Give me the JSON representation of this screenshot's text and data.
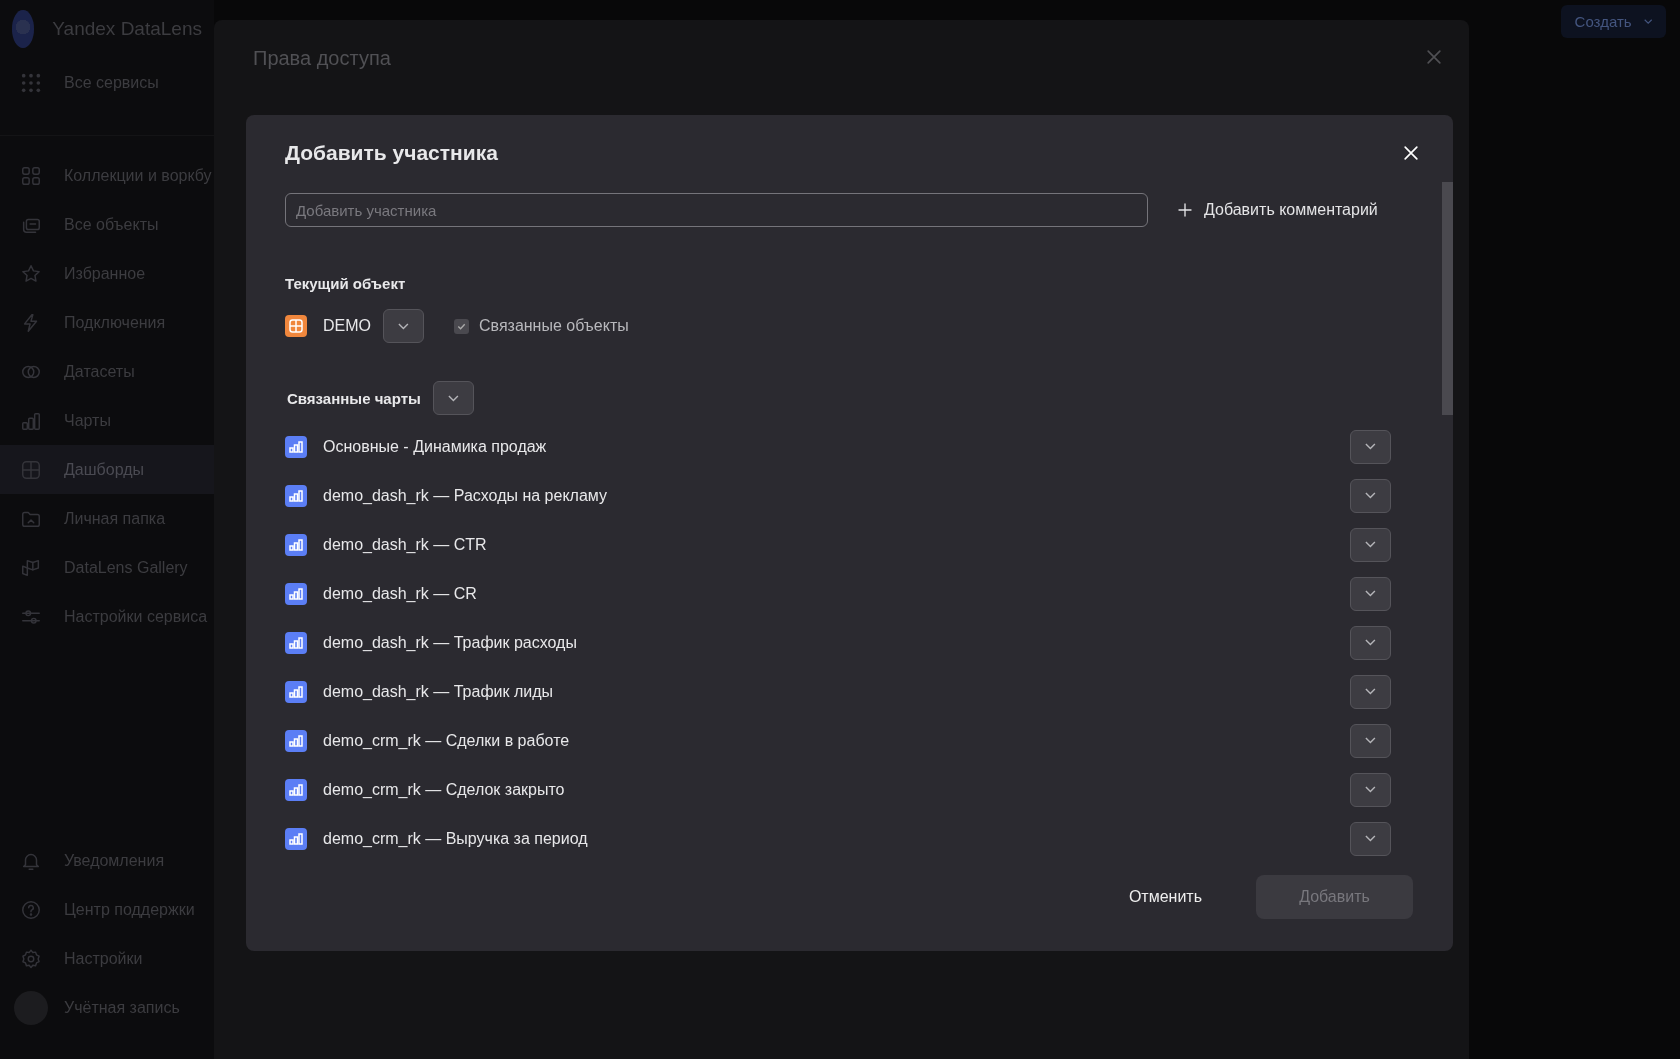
{
  "sidebar": {
    "logo": "Yandex DataLens",
    "services": "Все сервисы",
    "items": [
      {
        "label": "Коллекции и воркбу",
        "selected": false
      },
      {
        "label": "Все объекты",
        "selected": false
      },
      {
        "label": "Избранное",
        "selected": false
      },
      {
        "label": "Подключения",
        "selected": false
      },
      {
        "label": "Датасеты",
        "selected": false
      },
      {
        "label": "Чарты",
        "selected": false
      },
      {
        "label": "Дашборды",
        "selected": true
      },
      {
        "label": "Личная папка",
        "selected": false
      },
      {
        "label": "DataLens Gallery",
        "selected": false
      },
      {
        "label": "Настройки сервиса",
        "selected": false
      }
    ],
    "bottom_items": [
      {
        "label": "Уведомления"
      },
      {
        "label": "Центр поддержки"
      },
      {
        "label": "Настройки"
      }
    ],
    "account": "Учётная запись"
  },
  "top_bar": {
    "create_button": "Создать"
  },
  "access_dialog": {
    "title": "Права доступа"
  },
  "add_member_dialog": {
    "title": "Добавить участника",
    "search": {
      "placeholder": "Добавить участника"
    },
    "add_comment": "Добавить комментарий",
    "current_object": {
      "heading": "Текущий объект",
      "name": "DEMO",
      "related": {
        "label": "Связанные объекты",
        "checked": true
      }
    },
    "related_charts": {
      "heading": "Связанные чарты",
      "items": [
        "Основные - Динамика продаж",
        "demo_dash_rk — Расходы на рекламу",
        "demo_dash_rk — CTR",
        "demo_dash_rk — CR",
        "demo_dash_rk — Трафик расходы",
        "demo_dash_rk — Трафик лиды",
        "demo_crm_rk — Сделки в работе",
        "demo_crm_rk — Сделок закрыто",
        "demo_crm_rk — Выручка за период"
      ]
    },
    "buttons": {
      "cancel": "Отменить",
      "add": {
        "label": "Добавить",
        "disabled": true
      }
    }
  }
}
